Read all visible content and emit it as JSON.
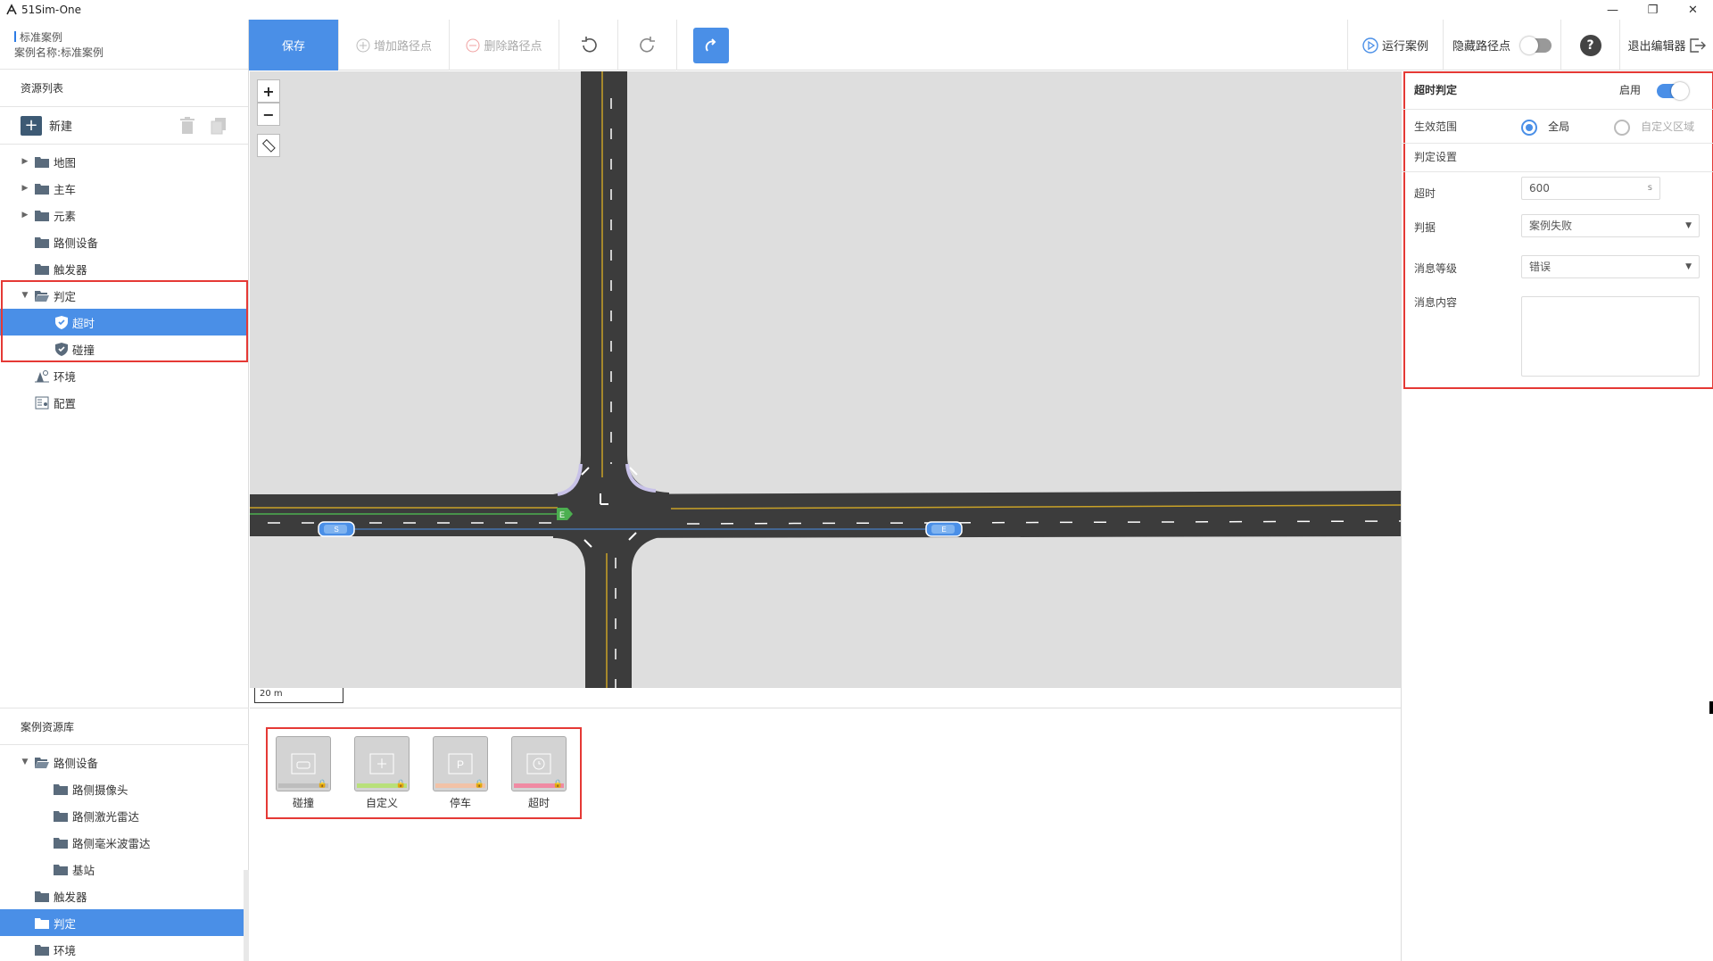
{
  "window": {
    "title": "51Sim-One",
    "controls": [
      "—",
      "❐",
      "✕"
    ]
  },
  "case_info": {
    "label": "标准案例",
    "name_line": "案例名称:标准案例"
  },
  "toolbar": {
    "save": "保存",
    "add_waypoint": "增加路径点",
    "delete_waypoint": "删除路径点",
    "run_case": "运行案例",
    "hide_waypoints": "隐藏路径点",
    "help": "?",
    "exit_editor": "退出编辑器"
  },
  "resource_list": {
    "title": "资源列表",
    "new_label": "新建",
    "items": [
      {
        "label": "地图",
        "caret": "▶"
      },
      {
        "label": "主车",
        "caret": "▶"
      },
      {
        "label": "元素",
        "caret": "▶"
      },
      {
        "label": "路侧设备",
        "caret": ""
      },
      {
        "label": "触发器",
        "caret": ""
      },
      {
        "label": "判定",
        "caret": "▼"
      },
      {
        "label": "超时",
        "caret": ""
      },
      {
        "label": "碰撞",
        "caret": ""
      },
      {
        "label": "环境",
        "caret": ""
      },
      {
        "label": "配置",
        "caret": ""
      }
    ]
  },
  "case_library": {
    "title": "案例资源库",
    "items": [
      {
        "label": "路侧设备",
        "caret": "▼"
      },
      {
        "label": "路侧摄像头",
        "caret": ""
      },
      {
        "label": "路侧激光雷达",
        "caret": ""
      },
      {
        "label": "路侧毫米波雷达",
        "caret": ""
      },
      {
        "label": "基站",
        "caret": ""
      },
      {
        "label": "触发器",
        "caret": ""
      },
      {
        "label": "判定",
        "caret": ""
      },
      {
        "label": "环境",
        "caret": ""
      }
    ]
  },
  "map": {
    "zoom_in": "+",
    "zoom_out": "−",
    "scale_label": "20 m",
    "start_marker": "S",
    "end_marker": "E"
  },
  "palette": {
    "items": [
      {
        "label": "碰撞",
        "stripe": "#bdbdbd"
      },
      {
        "label": "自定义",
        "stripe": "#b8e07a"
      },
      {
        "label": "停车",
        "stripe": "#f2c2a6"
      },
      {
        "label": "超时",
        "stripe": "#f08aa3"
      }
    ]
  },
  "right_panel": {
    "title": "超时判定",
    "enable_label": "启用",
    "scope_label": "生效范围",
    "scope_global": "全局",
    "scope_custom": "自定义区域",
    "settings_title": "判定设置",
    "timeout_label": "超时",
    "timeout_value": "600",
    "timeout_unit": "s",
    "judge_label": "判据",
    "judge_value": "案例失败",
    "level_label": "消息等级",
    "level_value": "错误",
    "content_label": "消息内容",
    "content_value": ""
  },
  "colors": {
    "accent": "#4a8fe7",
    "highlight": "#e53935",
    "road": "#3c3c3c",
    "map_bg": "#dedede"
  }
}
